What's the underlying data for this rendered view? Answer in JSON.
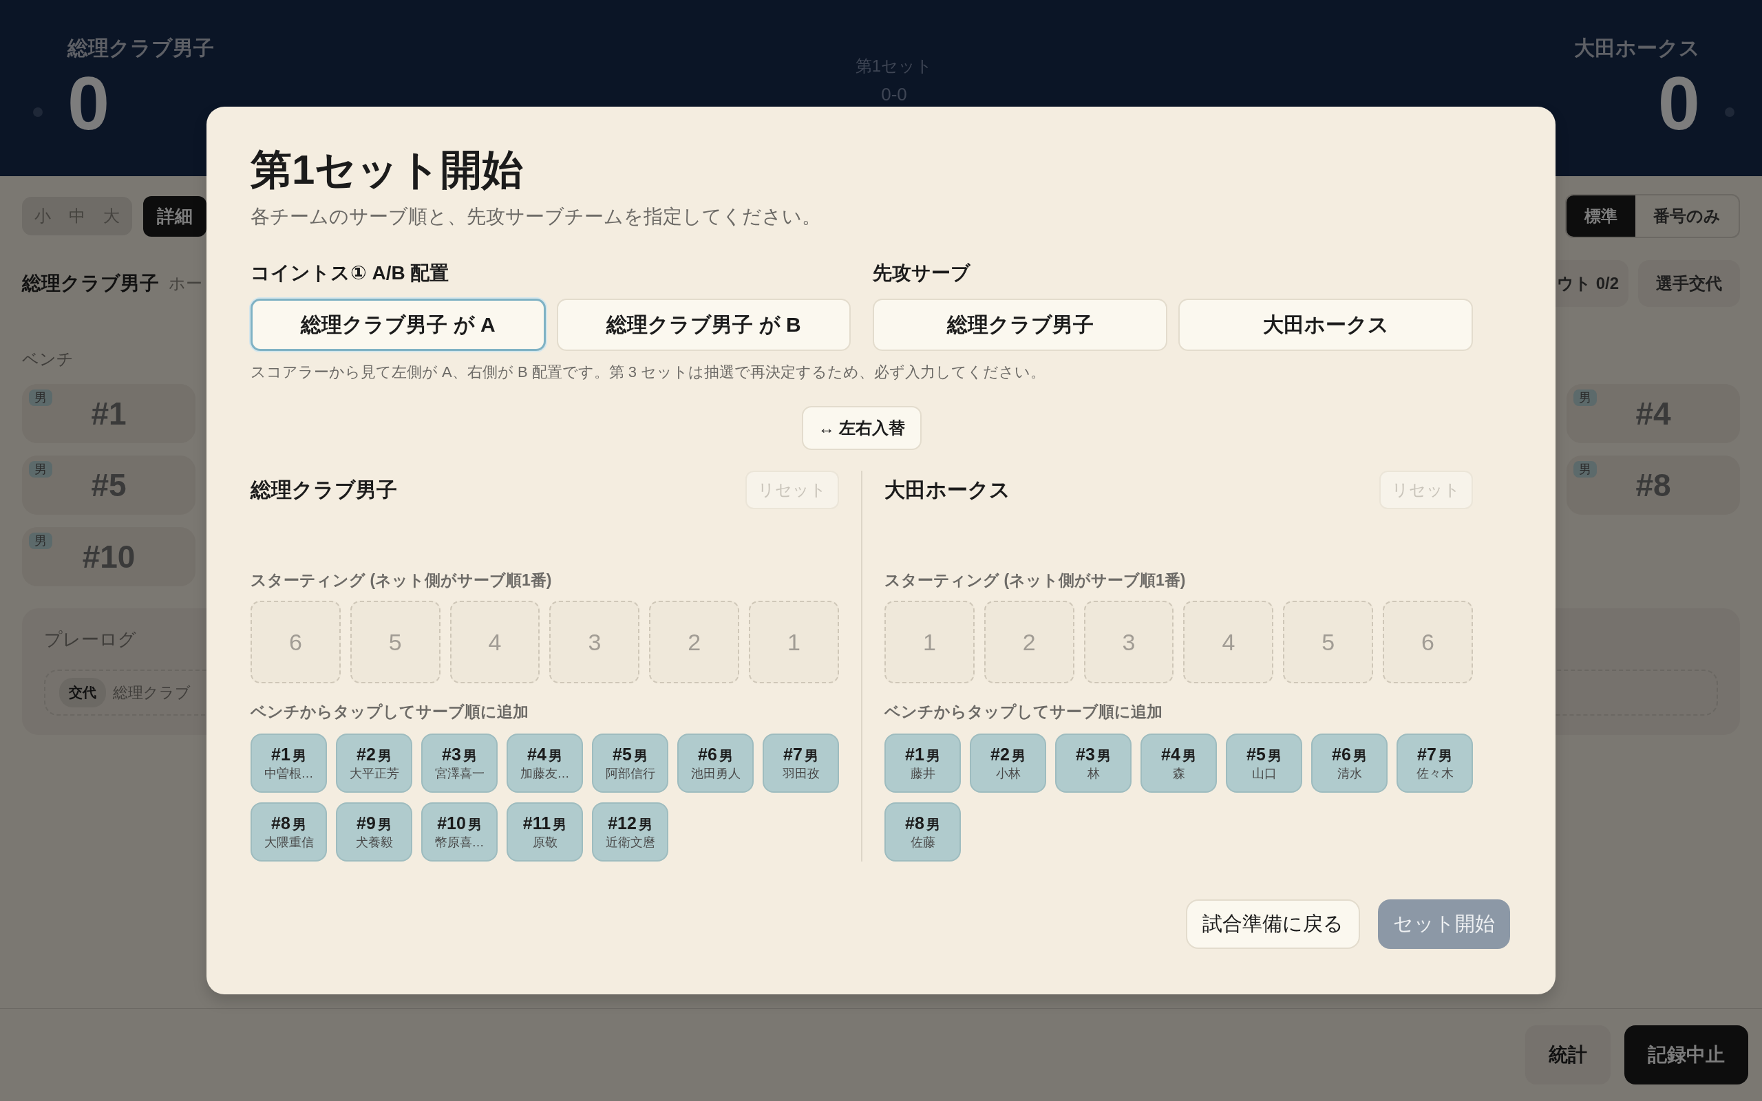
{
  "scoreboard": {
    "home": {
      "name": "総理クラブ男子",
      "score": "0"
    },
    "away": {
      "name": "大田ホークス",
      "score": "0"
    },
    "set_label": "第1セット",
    "set_score": "0-0"
  },
  "toolbar": {
    "size_options": [
      {
        "label": "小",
        "selected": false
      },
      {
        "label": "中",
        "selected": false
      },
      {
        "label": "大",
        "selected": false
      }
    ],
    "detail_toggle": {
      "label": "詳細",
      "on": true
    },
    "display_modes": [
      {
        "label": "標準",
        "selected": true
      },
      {
        "label": "番号のみ",
        "selected": false
      }
    ]
  },
  "team_bar": {
    "name": "総理クラブ男子",
    "side_label": "ホー",
    "buttons": [
      "ウト 0/2",
      "選手交代"
    ]
  },
  "bench": {
    "label": "ベンチ",
    "left_players": [
      {
        "number": "#1",
        "gender": "男"
      },
      {
        "number": "#5",
        "gender": "男"
      },
      {
        "number": "#10",
        "gender": "男"
      }
    ],
    "right_players": [
      {
        "number": "#4",
        "gender": "男"
      },
      {
        "number": "#8",
        "gender": "男"
      }
    ]
  },
  "play_log": {
    "title": "プレーログ",
    "entries": [
      {
        "tag": "交代",
        "text": "総理クラブ"
      }
    ]
  },
  "footer_buttons": [
    {
      "label": "統計",
      "kind": "secondary"
    },
    {
      "label": "記録中止",
      "kind": "primary"
    }
  ],
  "modal": {
    "title": "第1セット開始",
    "subtitle": "各チームのサーブ順と、先攻サーブチームを指定してください。",
    "coin_toss": {
      "label": "コイントス① A/B 配置",
      "options": [
        {
          "label": "総理クラブ男子 が A",
          "selected": true
        },
        {
          "label": "総理クラブ男子 が B",
          "selected": false
        }
      ]
    },
    "first_serve": {
      "label": "先攻サーブ",
      "options": [
        {
          "label": "総理クラブ男子",
          "selected": false
        },
        {
          "label": "大田ホークス",
          "selected": false
        }
      ]
    },
    "note": "スコアラーから見て左側が A、右側が B 配置です。第 3 セットは抽選で再決定するため、必ず入力してください。",
    "swap_button": {
      "icon": "↔",
      "label": "左右入替"
    },
    "teams": [
      {
        "name": "総理クラブ男子",
        "reset_label": "リセット",
        "reset_disabled": true,
        "starting_label": "スターティング (ネット側がサーブ順1番)",
        "slots": [
          "6",
          "5",
          "4",
          "3",
          "2",
          "1"
        ],
        "bench_label": "ベンチからタップしてサーブ順に追加",
        "bench": [
          {
            "number": "#1",
            "gender": "男",
            "name": "中曽根…"
          },
          {
            "number": "#2",
            "gender": "男",
            "name": "大平正芳"
          },
          {
            "number": "#3",
            "gender": "男",
            "name": "宮澤喜一"
          },
          {
            "number": "#4",
            "gender": "男",
            "name": "加藤友…"
          },
          {
            "number": "#5",
            "gender": "男",
            "name": "阿部信行"
          },
          {
            "number": "#6",
            "gender": "男",
            "name": "池田勇人"
          },
          {
            "number": "#7",
            "gender": "男",
            "name": "羽田孜"
          },
          {
            "number": "#8",
            "gender": "男",
            "name": "大隈重信"
          },
          {
            "number": "#9",
            "gender": "男",
            "name": "犬養毅"
          },
          {
            "number": "#10",
            "gender": "男",
            "name": "幣原喜…"
          },
          {
            "number": "#11",
            "gender": "男",
            "name": "原敬"
          },
          {
            "number": "#12",
            "gender": "男",
            "name": "近衛文麿"
          }
        ]
      },
      {
        "name": "大田ホークス",
        "reset_label": "リセット",
        "reset_disabled": true,
        "starting_label": "スターティング (ネット側がサーブ順1番)",
        "slots": [
          "1",
          "2",
          "3",
          "4",
          "5",
          "6"
        ],
        "bench_label": "ベンチからタップしてサーブ順に追加",
        "bench": [
          {
            "number": "#1",
            "gender": "男",
            "name": "藤井"
          },
          {
            "number": "#2",
            "gender": "男",
            "name": "小林"
          },
          {
            "number": "#3",
            "gender": "男",
            "name": "林"
          },
          {
            "number": "#4",
            "gender": "男",
            "name": "森"
          },
          {
            "number": "#5",
            "gender": "男",
            "name": "山口"
          },
          {
            "number": "#6",
            "gender": "男",
            "name": "清水"
          },
          {
            "number": "#7",
            "gender": "男",
            "name": "佐々木"
          },
          {
            "number": "#8",
            "gender": "男",
            "name": "佐藤"
          }
        ]
      }
    ],
    "actions": [
      {
        "label": "試合準備に戻る",
        "kind": "secondary",
        "disabled": false
      },
      {
        "label": "セット開始",
        "kind": "primary",
        "disabled": true
      }
    ]
  }
}
